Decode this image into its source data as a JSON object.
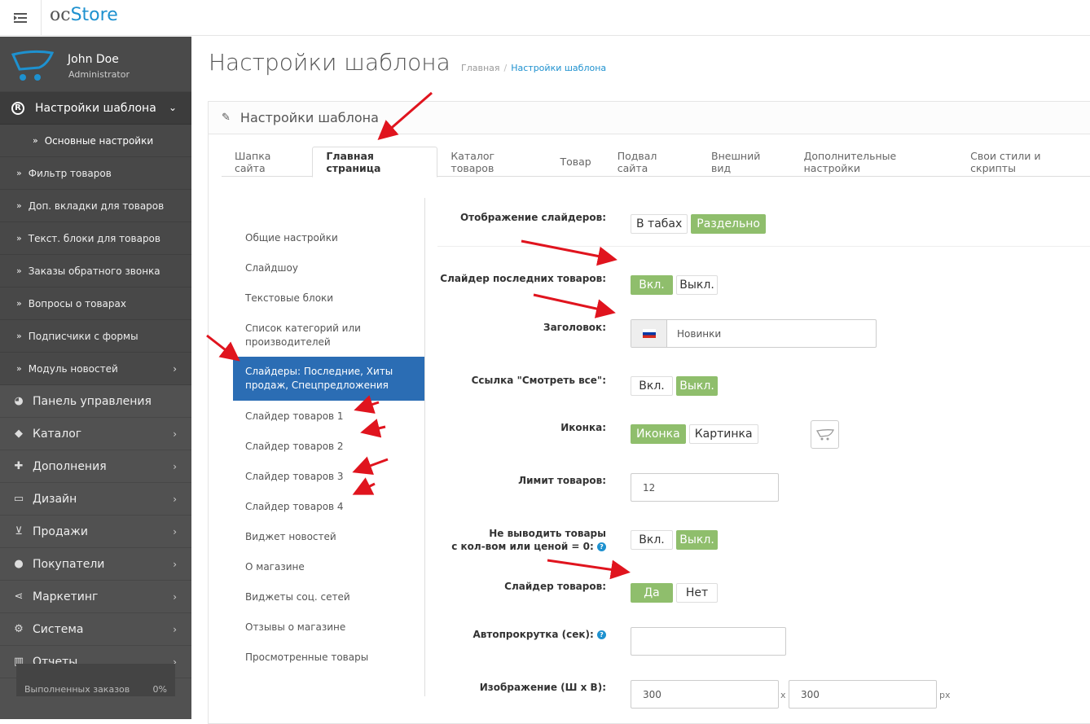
{
  "header": {
    "logo_oc": "oc",
    "logo_store": "Store"
  },
  "profile": {
    "name": "John Doe",
    "role": "Administrator"
  },
  "sidebar": {
    "active_section": "Настройки шаблона",
    "subitems": [
      {
        "label": "Основные настройки"
      },
      {
        "label": "Фильтр товаров"
      },
      {
        "label": "Доп. вкладки для товаров"
      },
      {
        "label": "Текст. блоки для товаров"
      },
      {
        "label": "Заказы обратного звонка"
      },
      {
        "label": "Вопросы о товарах"
      },
      {
        "label": "Подписчики с формы"
      },
      {
        "label": "Модуль новостей"
      }
    ],
    "items": [
      {
        "label": "Панель управления",
        "icon": "dashboard-icon"
      },
      {
        "label": "Каталог",
        "icon": "tag-icon"
      },
      {
        "label": "Дополнения",
        "icon": "puzzle-icon"
      },
      {
        "label": "Дизайн",
        "icon": "monitor-icon"
      },
      {
        "label": "Продажи",
        "icon": "cart-icon"
      },
      {
        "label": "Покупатели",
        "icon": "user-icon"
      },
      {
        "label": "Маркетинг",
        "icon": "share-icon"
      },
      {
        "label": "Система",
        "icon": "cog-icon"
      },
      {
        "label": "Отчеты",
        "icon": "bar-chart-icon"
      }
    ],
    "progress_label": "Выполненных заказов",
    "progress_value": "0%"
  },
  "page": {
    "title": "Настройки шаблона",
    "breadcrumb_home": "Главная",
    "breadcrumb_current": "Настройки шаблона",
    "panel_title": "Настройки шаблона"
  },
  "tabs": [
    {
      "label": "Шапка сайта"
    },
    {
      "label": "Главная страница"
    },
    {
      "label": "Каталог товаров"
    },
    {
      "label": "Товар"
    },
    {
      "label": "Подвал сайта"
    },
    {
      "label": "Внешний вид"
    },
    {
      "label": "Дополнительные настройки"
    },
    {
      "label": "Свои стили и скрипты"
    }
  ],
  "vnav": [
    {
      "label": "Общие настройки"
    },
    {
      "label": "Слайдшоу"
    },
    {
      "label": "Текстовые блоки"
    },
    {
      "label": "Список категорий или производителей"
    },
    {
      "label": "Слайдеры: Последние, Хиты продаж, Спецпредложения"
    },
    {
      "label": "Слайдер товаров 1"
    },
    {
      "label": "Слайдер товаров 2"
    },
    {
      "label": "Слайдер товаров 3"
    },
    {
      "label": "Слайдер товаров 4"
    },
    {
      "label": "Виджет новостей"
    },
    {
      "label": "О магазине"
    },
    {
      "label": "Виджеты соц. сетей"
    },
    {
      "label": "Отзывы о магазине"
    },
    {
      "label": "Просмотренные товары"
    }
  ],
  "form": {
    "sliders_display": {
      "label": "Отображение слайдеров:",
      "opt1": "В табах",
      "opt2": "Раздельно"
    },
    "latest_slider": {
      "label": "Слайдер последних товаров:",
      "on": "Вкл.",
      "off": "Выкл."
    },
    "heading": {
      "label": "Заголовок:",
      "value": "Новинки"
    },
    "see_all": {
      "label": "Ссылка \"Смотреть все\":",
      "on": "Вкл.",
      "off": "Выкл."
    },
    "icon": {
      "label": "Иконка:",
      "opt1": "Иконка",
      "opt2": "Картинка"
    },
    "limit": {
      "label": "Лимит товаров:",
      "value": "12"
    },
    "hide_zero": {
      "label1": "Не выводить товары",
      "label2": "с кол-вом или ценой = 0:",
      "on": "Вкл.",
      "off": "Выкл."
    },
    "slider": {
      "label": "Слайдер товаров:",
      "yes": "Да",
      "no": "Нет"
    },
    "autoplay": {
      "label": "Автопрокрутка (сек):",
      "value": ""
    },
    "image": {
      "label": "Изображение (Ш х В):",
      "width": "300",
      "height": "300",
      "x": "x",
      "unit": "px"
    }
  }
}
